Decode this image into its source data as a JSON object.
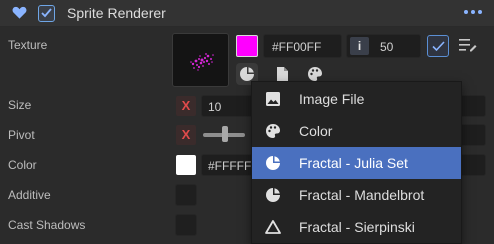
{
  "component": {
    "title": "Sprite Renderer",
    "enabled": true
  },
  "properties": {
    "texture_label": "Texture",
    "size_label": "Size",
    "pivot_label": "Pivot",
    "color_label": "Color",
    "additive_label": "Additive",
    "cast_shadows_label": "Cast Shadows"
  },
  "texture": {
    "color_hex": "#FF00FF",
    "swatch_color": "#ff00ff",
    "iterations_icon": "i",
    "iterations_value": "50"
  },
  "size": {
    "axis_label": "X",
    "value": "10"
  },
  "pivot": {
    "axis_label": "X"
  },
  "color": {
    "hex": "#FFFFFF",
    "swatch_color": "#ffffff"
  },
  "dropdown": {
    "items": [
      {
        "label": "Image File",
        "icon": "image-icon",
        "selected": false
      },
      {
        "label": "Color",
        "icon": "palette-icon",
        "selected": false
      },
      {
        "label": "Fractal - Julia Set",
        "icon": "fractal-icon",
        "selected": true
      },
      {
        "label": "Fractal - Mandelbrot",
        "icon": "fractal-icon",
        "selected": false
      },
      {
        "label": "Fractal - Sierpinski",
        "icon": "triangle-icon",
        "selected": false
      }
    ]
  }
}
